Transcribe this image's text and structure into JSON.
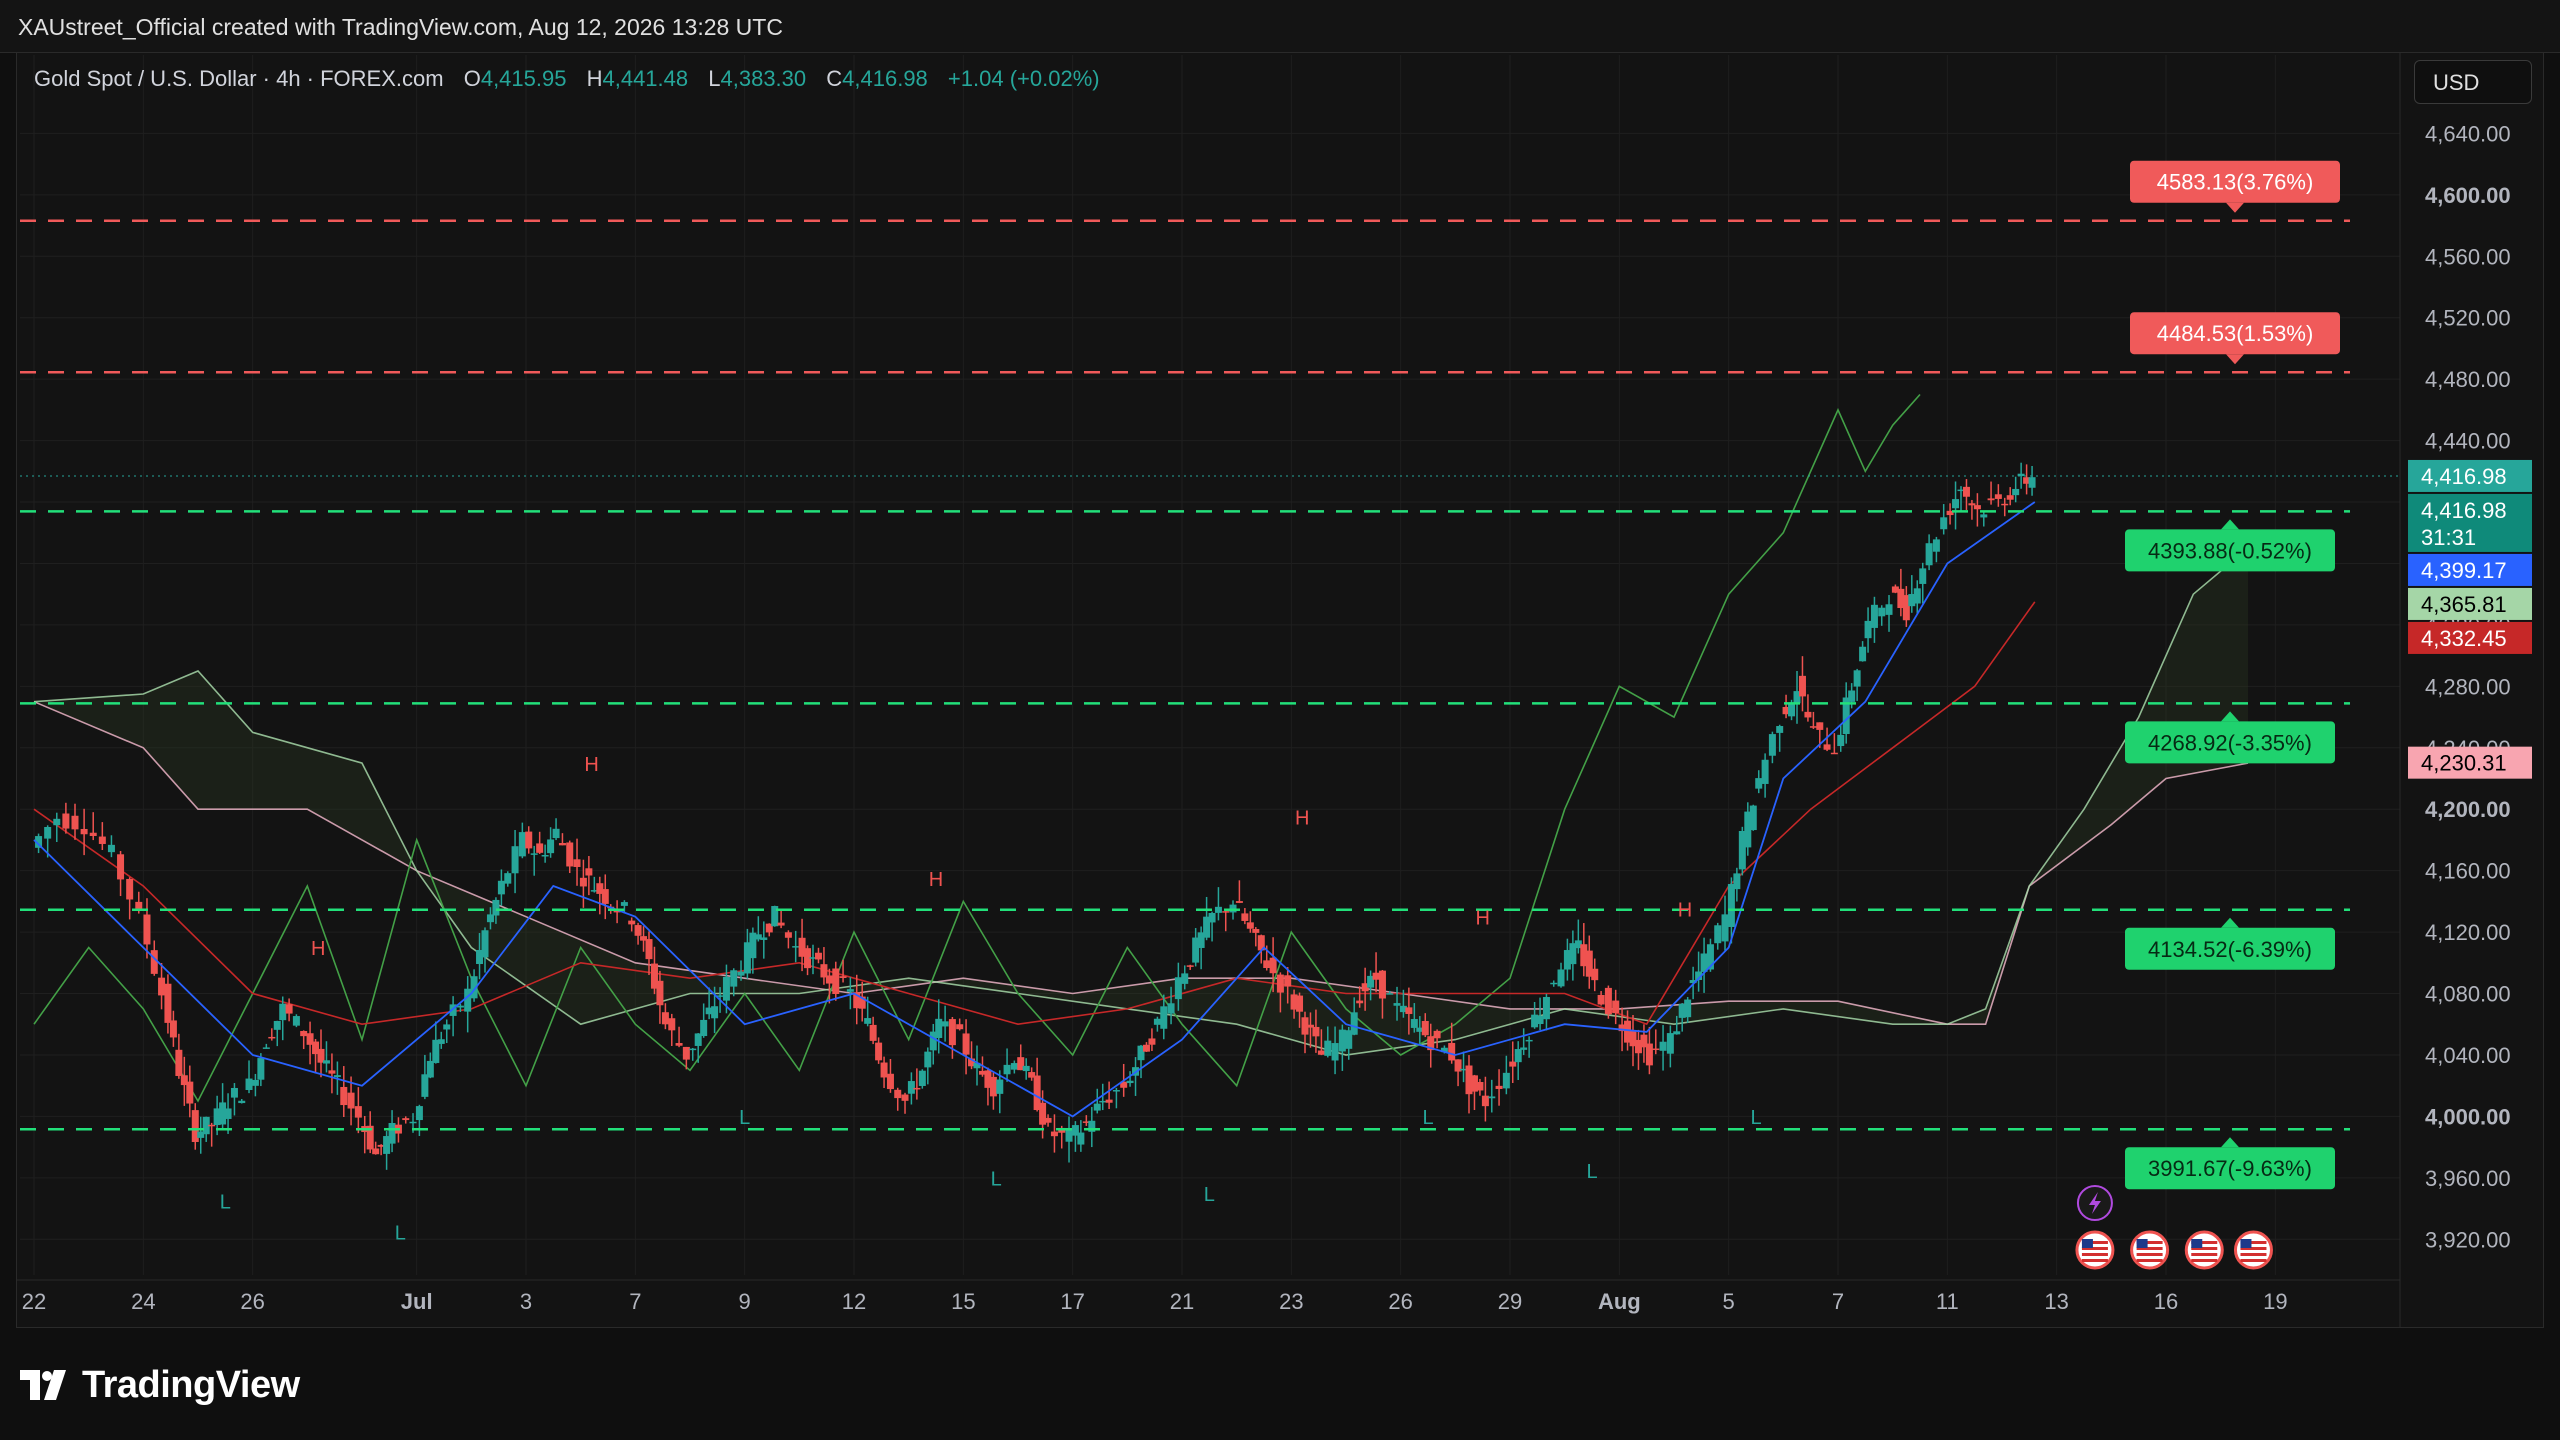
{
  "header": {
    "credit": "XAUstreet_Official created with TradingView.com, Aug 12, 2026 13:28 UTC"
  },
  "legend": {
    "symbol": "Gold Spot / U.S. Dollar · 4h · FOREX.com",
    "o_label": "O",
    "o_value": "4,415.95",
    "h_label": "H",
    "h_value": "4,441.48",
    "l_label": "L",
    "l_value": "4,383.30",
    "c_label": "C",
    "c_value": "4,416.98",
    "change": "+1.04 (+0.02%)"
  },
  "currency": "USD",
  "footer": {
    "brand": "TradingView"
  },
  "colors": {
    "up": "#26a69a",
    "down": "#ef5350",
    "red_level": "#f05a5a",
    "green_level": "#22e07a",
    "conversion": "#2962ff",
    "base": "#c62828",
    "lagging": "#43a047",
    "span_a": "#a5d6a7",
    "span_b": "#f8bbd0"
  },
  "chart_data": {
    "type": "candlestick",
    "title": "Gold Spot / U.S. Dollar · 4h · FOREX.com",
    "y_ticks": [
      "4,640.00",
      "4,600.00",
      "4,560.00",
      "4,520.00",
      "4,480.00",
      "4,440.00",
      "4,400.00",
      "4,360.00",
      "4,320.00",
      "4,280.00",
      "4,240.00",
      "4,200.00",
      "4,160.00",
      "4,120.00",
      "4,080.00",
      "4,040.00",
      "4,000.00",
      "3,960.00",
      "3,920.00"
    ],
    "y_tick_values": [
      4640,
      4600,
      4560,
      4520,
      4480,
      4440,
      4400,
      4360,
      4320,
      4280,
      4240,
      4200,
      4160,
      4120,
      4080,
      4040,
      4000,
      3960,
      3920
    ],
    "bold_ticks": [
      4600,
      4200,
      4000
    ],
    "x_ticks": [
      {
        "label": "22",
        "day": 0
      },
      {
        "label": "24",
        "day": 2
      },
      {
        "label": "26",
        "day": 4
      },
      {
        "label": "Jul",
        "day": 7,
        "bold": true
      },
      {
        "label": "3",
        "day": 9
      },
      {
        "label": "7",
        "day": 11
      },
      {
        "label": "9",
        "day": 13
      },
      {
        "label": "12",
        "day": 15
      },
      {
        "label": "15",
        "day": 17
      },
      {
        "label": "17",
        "day": 19
      },
      {
        "label": "21",
        "day": 21
      },
      {
        "label": "23",
        "day": 23
      },
      {
        "label": "26",
        "day": 25
      },
      {
        "label": "29",
        "day": 27
      },
      {
        "label": "Aug",
        "day": 29,
        "bold": true
      },
      {
        "label": "5",
        "day": 31
      },
      {
        "label": "7",
        "day": 33
      },
      {
        "label": "11",
        "day": 35
      },
      {
        "label": "13",
        "day": 37
      },
      {
        "label": "16",
        "day": 39
      },
      {
        "label": "19",
        "day": 41
      }
    ],
    "y_range": [
      3900,
      4665
    ],
    "x_range_days": [
      0,
      42
    ],
    "price_path": [
      [
        0,
        4175
      ],
      [
        0.5,
        4195
      ],
      [
        1,
        4190
      ],
      [
        1.5,
        4170
      ],
      [
        2,
        4130
      ],
      [
        2.4,
        4080
      ],
      [
        2.7,
        4030
      ],
      [
        3,
        3990
      ],
      [
        3.3,
        3995
      ],
      [
        3.6,
        4010
      ],
      [
        4,
        4020
      ],
      [
        4.3,
        4050
      ],
      [
        4.6,
        4070
      ],
      [
        5,
        4055
      ],
      [
        5.3,
        4035
      ],
      [
        5.6,
        4020
      ],
      [
        6,
        4000
      ],
      [
        6.3,
        3975
      ],
      [
        6.6,
        3990
      ],
      [
        7,
        4000
      ],
      [
        7.3,
        4040
      ],
      [
        7.6,
        4060
      ],
      [
        8,
        4080
      ],
      [
        8.3,
        4120
      ],
      [
        8.6,
        4150
      ],
      [
        9,
        4180
      ],
      [
        9.3,
        4170
      ],
      [
        9.6,
        4185
      ],
      [
        10,
        4160
      ],
      [
        10.3,
        4150
      ],
      [
        10.6,
        4140
      ],
      [
        11,
        4130
      ],
      [
        11.3,
        4100
      ],
      [
        11.6,
        4060
      ],
      [
        12,
        4040
      ],
      [
        12.3,
        4060
      ],
      [
        12.6,
        4080
      ],
      [
        13,
        4100
      ],
      [
        13.3,
        4120
      ],
      [
        13.6,
        4130
      ],
      [
        14,
        4110
      ],
      [
        14.3,
        4100
      ],
      [
        14.6,
        4090
      ],
      [
        15,
        4080
      ],
      [
        15.3,
        4060
      ],
      [
        15.6,
        4030
      ],
      [
        16,
        4010
      ],
      [
        16.3,
        4030
      ],
      [
        16.6,
        4060
      ],
      [
        17,
        4050
      ],
      [
        17.3,
        4030
      ],
      [
        17.6,
        4020
      ],
      [
        18,
        4040
      ],
      [
        18.3,
        4020
      ],
      [
        18.6,
        3990
      ],
      [
        19,
        3985
      ],
      [
        19.3,
        3995
      ],
      [
        19.6,
        4010
      ],
      [
        20,
        4020
      ],
      [
        20.3,
        4040
      ],
      [
        20.6,
        4060
      ],
      [
        21,
        4090
      ],
      [
        21.3,
        4110
      ],
      [
        21.6,
        4130
      ],
      [
        22,
        4140
      ],
      [
        22.3,
        4120
      ],
      [
        22.6,
        4100
      ],
      [
        23,
        4080
      ],
      [
        23.3,
        4060
      ],
      [
        23.6,
        4040
      ],
      [
        24,
        4050
      ],
      [
        24.3,
        4080
      ],
      [
        24.6,
        4090
      ],
      [
        25,
        4070
      ],
      [
        25.3,
        4060
      ],
      [
        25.6,
        4050
      ],
      [
        26,
        4040
      ],
      [
        26.3,
        4020
      ],
      [
        26.6,
        4010
      ],
      [
        27,
        4030
      ],
      [
        27.3,
        4050
      ],
      [
        27.6,
        4070
      ],
      [
        28,
        4100
      ],
      [
        28.3,
        4110
      ],
      [
        28.6,
        4085
      ],
      [
        29,
        4065
      ],
      [
        29.3,
        4050
      ],
      [
        29.6,
        4040
      ],
      [
        30,
        4050
      ],
      [
        30.3,
        4080
      ],
      [
        30.6,
        4100
      ],
      [
        31,
        4130
      ],
      [
        31.3,
        4180
      ],
      [
        31.6,
        4220
      ],
      [
        32,
        4260
      ],
      [
        32.3,
        4280
      ],
      [
        32.6,
        4250
      ],
      [
        33,
        4240
      ],
      [
        33.3,
        4280
      ],
      [
        33.6,
        4320
      ],
      [
        34,
        4340
      ],
      [
        34.3,
        4330
      ],
      [
        34.6,
        4360
      ],
      [
        35,
        4390
      ],
      [
        35.3,
        4410
      ],
      [
        35.6,
        4395
      ],
      [
        36,
        4400
      ],
      [
        36.3,
        4410
      ],
      [
        36.6,
        4417
      ]
    ],
    "ichimoku": {
      "conversion": [
        [
          0,
          4180
        ],
        [
          2,
          4110
        ],
        [
          4,
          4040
        ],
        [
          6,
          4020
        ],
        [
          8,
          4080
        ],
        [
          9.5,
          4150
        ],
        [
          11,
          4130
        ],
        [
          13,
          4060
        ],
        [
          15,
          4080
        ],
        [
          17,
          4040
        ],
        [
          19,
          4000
        ],
        [
          21,
          4050
        ],
        [
          22.5,
          4110
        ],
        [
          24,
          4060
        ],
        [
          26,
          4040
        ],
        [
          28,
          4060
        ],
        [
          29.5,
          4055
        ],
        [
          31,
          4110
        ],
        [
          32,
          4220
        ],
        [
          33.5,
          4270
        ],
        [
          35,
          4360
        ],
        [
          36.6,
          4400
        ]
      ],
      "base": [
        [
          0,
          4200
        ],
        [
          2,
          4150
        ],
        [
          4,
          4080
        ],
        [
          6,
          4060
        ],
        [
          8,
          4070
        ],
        [
          10,
          4100
        ],
        [
          12,
          4090
        ],
        [
          14,
          4100
        ],
        [
          16,
          4080
        ],
        [
          18,
          4060
        ],
        [
          20,
          4070
        ],
        [
          22,
          4090
        ],
        [
          24,
          4080
        ],
        [
          26,
          4080
        ],
        [
          28,
          4080
        ],
        [
          29.5,
          4060
        ],
        [
          31,
          4150
        ],
        [
          32.5,
          4200
        ],
        [
          34,
          4240
        ],
        [
          35.5,
          4280
        ],
        [
          36.6,
          4335
        ]
      ],
      "span_a": [
        [
          0,
          4270
        ],
        [
          2,
          4275
        ],
        [
          3,
          4290
        ],
        [
          4,
          4250
        ],
        [
          6,
          4230
        ],
        [
          7,
          4160
        ],
        [
          8,
          4110
        ],
        [
          10,
          4060
        ],
        [
          12,
          4080
        ],
        [
          14,
          4080
        ],
        [
          16,
          4090
        ],
        [
          18,
          4080
        ],
        [
          20,
          4070
        ],
        [
          22,
          4060
        ],
        [
          24,
          4040
        ],
        [
          26,
          4050
        ],
        [
          28,
          4070
        ],
        [
          30,
          4060
        ],
        [
          32,
          4070
        ],
        [
          34,
          4060
        ],
        [
          35,
          4060
        ],
        [
          35.7,
          4070
        ],
        [
          36.5,
          4150
        ],
        [
          37.5,
          4200
        ],
        [
          38.5,
          4260
        ],
        [
          39.5,
          4340
        ],
        [
          40.5,
          4370
        ]
      ],
      "span_b": [
        [
          0,
          4270
        ],
        [
          2,
          4240
        ],
        [
          3,
          4200
        ],
        [
          5,
          4200
        ],
        [
          6,
          4180
        ],
        [
          7,
          4160
        ],
        [
          9,
          4130
        ],
        [
          11,
          4100
        ],
        [
          13,
          4090
        ],
        [
          15,
          4080
        ],
        [
          17,
          4090
        ],
        [
          19,
          4080
        ],
        [
          21,
          4090
        ],
        [
          23,
          4090
        ],
        [
          25,
          4080
        ],
        [
          27,
          4070
        ],
        [
          29,
          4070
        ],
        [
          31,
          4075
        ],
        [
          33,
          4075
        ],
        [
          35,
          4060
        ],
        [
          35.7,
          4060
        ],
        [
          36.5,
          4150
        ],
        [
          38,
          4190
        ],
        [
          39,
          4220
        ],
        [
          40.5,
          4230
        ]
      ],
      "lagging": [
        [
          0,
          4060
        ],
        [
          1,
          4110
        ],
        [
          2,
          4070
        ],
        [
          3,
          4010
        ],
        [
          4,
          4080
        ],
        [
          5,
          4150
        ],
        [
          6,
          4050
        ],
        [
          7,
          4180
        ],
        [
          8,
          4090
        ],
        [
          9,
          4020
        ],
        [
          10,
          4110
        ],
        [
          11,
          4060
        ],
        [
          12,
          4030
        ],
        [
          13,
          4080
        ],
        [
          14,
          4030
        ],
        [
          15,
          4120
        ],
        [
          16,
          4050
        ],
        [
          17,
          4140
        ],
        [
          18,
          4080
        ],
        [
          19,
          4040
        ],
        [
          20,
          4110
        ],
        [
          21,
          4060
        ],
        [
          22,
          4020
        ],
        [
          23,
          4120
        ],
        [
          24,
          4070
        ],
        [
          25,
          4040
        ],
        [
          26,
          4060
        ],
        [
          27,
          4090
        ],
        [
          28,
          4200
        ],
        [
          29,
          4280
        ],
        [
          30,
          4260
        ],
        [
          31,
          4340
        ],
        [
          32,
          4380
        ],
        [
          33,
          4460
        ],
        [
          33.5,
          4420
        ],
        [
          34,
          4450
        ],
        [
          34.5,
          4470
        ]
      ]
    },
    "levels": [
      {
        "price": 4583.13,
        "label": "4583.13(3.76%)",
        "kind": "red"
      },
      {
        "price": 4484.53,
        "label": "4484.53(1.53%)",
        "kind": "red"
      },
      {
        "price": 4393.88,
        "label": "4393.88(-0.52%)",
        "kind": "green"
      },
      {
        "price": 4268.92,
        "label": "4268.92(-3.35%)",
        "kind": "green"
      },
      {
        "price": 4134.52,
        "label": "4134.52(-6.39%)",
        "kind": "green"
      },
      {
        "price": 3991.67,
        "label": "3991.67(-9.63%)",
        "kind": "green"
      }
    ],
    "price_tags": [
      {
        "price": 4416.98,
        "label": "4,416.98",
        "bg": "#26a69a",
        "fg": "#ffffff"
      },
      {
        "price": 4416.98,
        "label": "4,416.98",
        "sub": "31:31",
        "bg": "#0f8a7a",
        "fg": "#ffffff",
        "offset": 1
      },
      {
        "price": 4399.17,
        "label": "4,399.17",
        "bg": "#2962ff",
        "fg": "#ffffff"
      },
      {
        "price": 4365.81,
        "label": "4,365.81",
        "bg": "#a5d6a7",
        "fg": "#000000"
      },
      {
        "price": 4332.45,
        "label": "4,332.45",
        "bg": "#c62828",
        "fg": "#ffffff"
      },
      {
        "price": 4230.31,
        "label": "4,230.31",
        "bg": "#f8a5b0",
        "fg": "#000000"
      }
    ],
    "pivot_marks": [
      {
        "text": "H",
        "day": 10.2,
        "price": 4225
      },
      {
        "text": "H",
        "day": 16.5,
        "price": 4150
      },
      {
        "text": "H",
        "day": 5.2,
        "price": 4105
      },
      {
        "text": "H",
        "day": 23.2,
        "price": 4190
      },
      {
        "text": "H",
        "day": 26.5,
        "price": 4125
      },
      {
        "text": "H",
        "day": 30.2,
        "price": 4130
      },
      {
        "text": "L",
        "day": 3.5,
        "price": 3940
      },
      {
        "text": "L",
        "day": 6.7,
        "price": 3920
      },
      {
        "text": "L",
        "day": 13,
        "price": 3995
      },
      {
        "text": "L",
        "day": 17.6,
        "price": 3955
      },
      {
        "text": "L",
        "day": 21.5,
        "price": 3945
      },
      {
        "text": "L",
        "day": 25.5,
        "price": 3995
      },
      {
        "text": "L",
        "day": 28.5,
        "price": 3960
      },
      {
        "text": "L",
        "day": 31.5,
        "price": 3995
      }
    ],
    "events": [
      {
        "icon": "lightning-icon",
        "day": 37.7,
        "row": 0
      },
      {
        "icon": "us-flag-icon",
        "day": 37.7,
        "row": 1
      },
      {
        "icon": "us-flag-icon",
        "day": 38.7,
        "row": 1
      },
      {
        "icon": "us-flag-icon",
        "day": 39.7,
        "row": 1
      },
      {
        "icon": "us-flag-icon",
        "day": 40.6,
        "row": 1
      }
    ]
  }
}
